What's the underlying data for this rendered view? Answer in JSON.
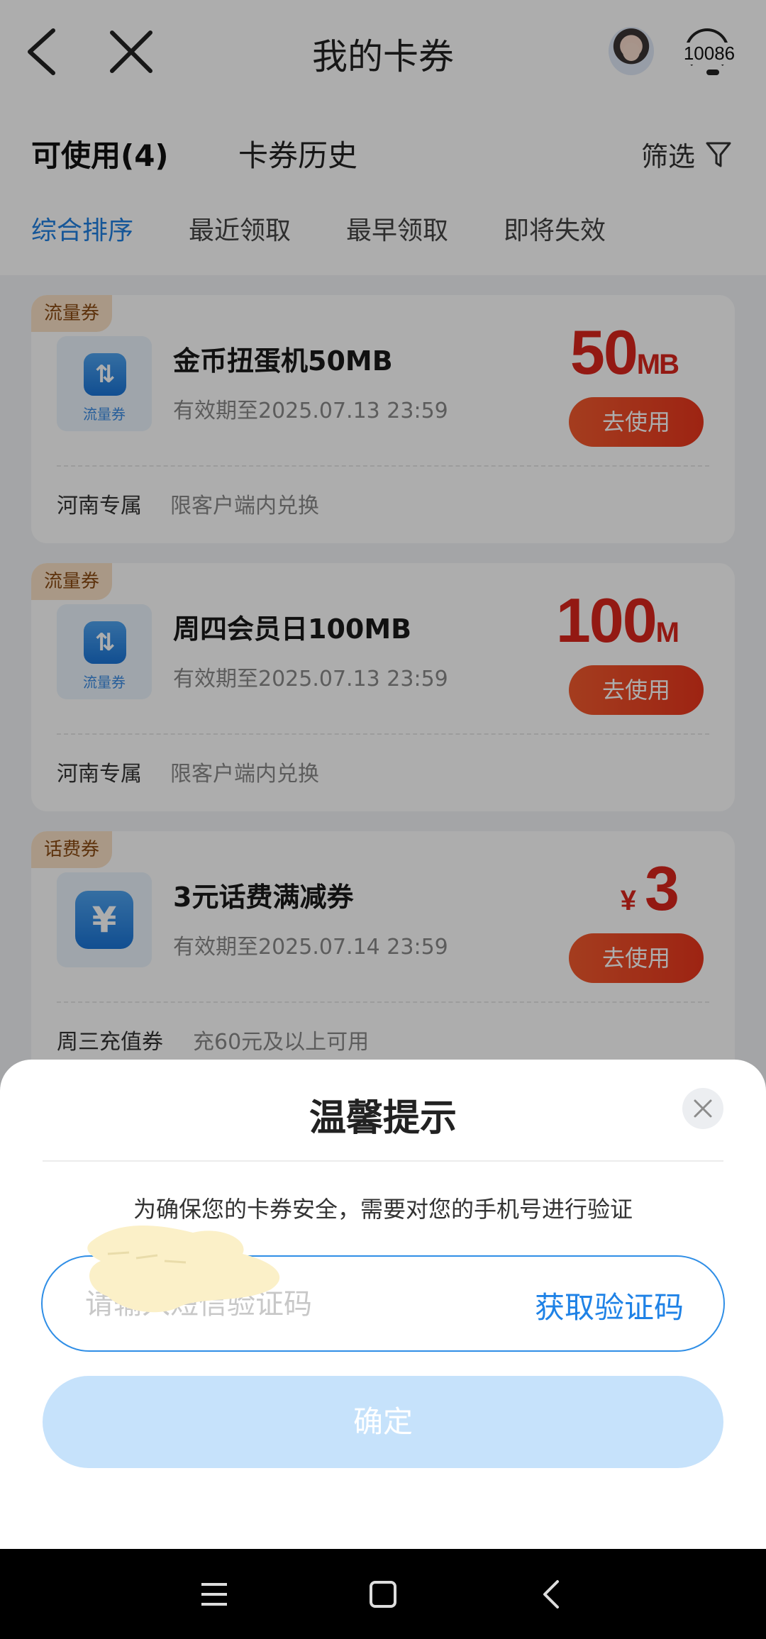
{
  "header": {
    "title": "我的卡券",
    "service_number": "10086"
  },
  "tabs": {
    "available": "可使用(4)",
    "history": "卡券历史",
    "filter": "筛选"
  },
  "sort_options": [
    "综合排序",
    "最近领取",
    "最早领取",
    "即将失效"
  ],
  "coupons": [
    {
      "badge": "流量券",
      "icon_label": "流量券",
      "name": "金币扭蛋机50MB",
      "expiry": "有效期至2025.07.13 23:59",
      "amount_value": "50",
      "amount_unit": "MB",
      "button": "去使用",
      "region": "河南专属",
      "scope": "限客户端内兑换"
    },
    {
      "badge": "流量券",
      "icon_label": "流量券",
      "name": "周四会员日100MB",
      "expiry": "有效期至2025.07.13 23:59",
      "amount_value": "100",
      "amount_unit": "M",
      "button": "去使用",
      "region": "河南专属",
      "scope": "限客户端内兑换"
    },
    {
      "badge": "话费券",
      "name": "3元话费满减券",
      "expiry": "有效期至2025.07.14 23:59",
      "amount_currency": "¥",
      "amount_value": "3",
      "button": "去使用",
      "region": "周三充值券",
      "scope": "充60元及以上可用"
    }
  ],
  "dialog": {
    "title": "温馨提示",
    "message": "为确保您的卡券安全，需要对您的手机号进行验证",
    "input_placeholder": "请输入短信验证码",
    "get_code": "获取验证码",
    "confirm": "确定"
  },
  "colors": {
    "accent": "#1f7fe0",
    "price_red": "#d9251c",
    "button_red": "#e8351c",
    "confirm_disabled": "#c6e2fb"
  }
}
